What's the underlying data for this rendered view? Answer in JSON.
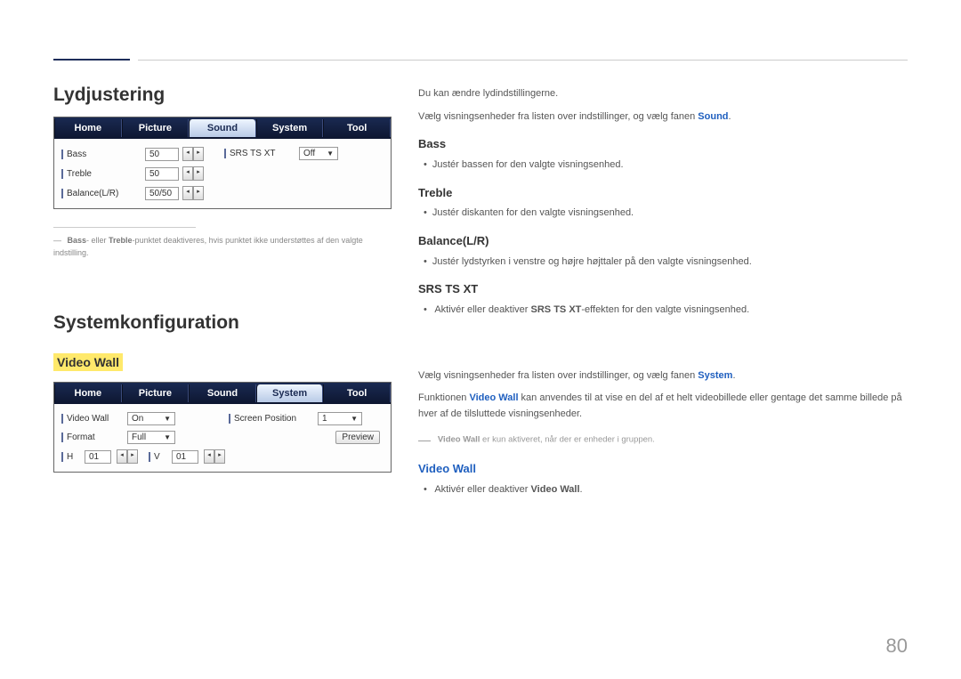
{
  "page_number": "80",
  "section1": {
    "title": "Lydjustering",
    "tabs": [
      "Home",
      "Picture",
      "Sound",
      "System",
      "Tool"
    ],
    "active_tab": 2,
    "rows": {
      "bass": "Bass",
      "bass_val": "50",
      "treble": "Treble",
      "treble_val": "50",
      "balance": "Balance(L/R)",
      "balance_val": "50/50",
      "srs": "SRS TS XT",
      "srs_val": "Off"
    },
    "footnote_pre": "― ",
    "footnote_bass": "Bass",
    "footnote_mid": "- eller ",
    "footnote_treble": "Treble",
    "footnote_after": "-punktet deaktiveres, hvis punktet ikke understøttes af den valgte indstilling."
  },
  "section2": {
    "title": "Systemkonfiguration",
    "subtitle": "Video Wall",
    "tabs": [
      "Home",
      "Picture",
      "Sound",
      "System",
      "Tool"
    ],
    "active_tab": 3,
    "rows": {
      "videowall": "Video Wall",
      "videowall_val": "On",
      "format": "Format",
      "format_val": "Full",
      "h": "H",
      "h_val": "01",
      "v": "V",
      "v_val": "01",
      "screenpos": "Screen Position",
      "screenpos_val": "1",
      "preview": "Preview"
    }
  },
  "right": {
    "intro1": "Du kan ændre lydindstillingerne.",
    "intro2a": "Vælg visningsenheder fra listen over indstillinger, og vælg fanen ",
    "intro2b": "Sound",
    "intro2c": ".",
    "bass": {
      "head": "Bass",
      "bullet": "Justér bassen for den valgte visningsenhed."
    },
    "treble": {
      "head": "Treble",
      "bullet": "Justér diskanten for den valgte visningsenhed."
    },
    "balance": {
      "head": "Balance(L/R)",
      "bullet": "Justér lydstyrken i venstre og højre højttaler på den valgte visningsenhed."
    },
    "srs": {
      "head": "SRS TS XT",
      "bullet_pre": "Aktivér eller deaktiver ",
      "bullet_bold": "SRS TS XT",
      "bullet_post": "-effekten for den valgte visningsenhed."
    },
    "sys_intro_a": "Vælg visningsenheder fra listen over indstillinger, og vælg fanen ",
    "sys_intro_b": "System",
    "sys_intro_c": ".",
    "sys_desc_a": "Funktionen ",
    "sys_desc_b": "Video Wall",
    "sys_desc_c": " kan anvendes til at vise en del af et helt videobillede eller gentage det samme billede på hver af de tilsluttede visningsenheder.",
    "sys_note_a": "― ",
    "sys_note_b": "Video Wall",
    "sys_note_c": " er kun aktiveret, når der er enheder i gruppen.",
    "videowall": {
      "head": "Video Wall",
      "bullet_pre": "Aktivér eller deaktiver ",
      "bullet_bold": "Video Wall",
      "bullet_post": "."
    }
  }
}
